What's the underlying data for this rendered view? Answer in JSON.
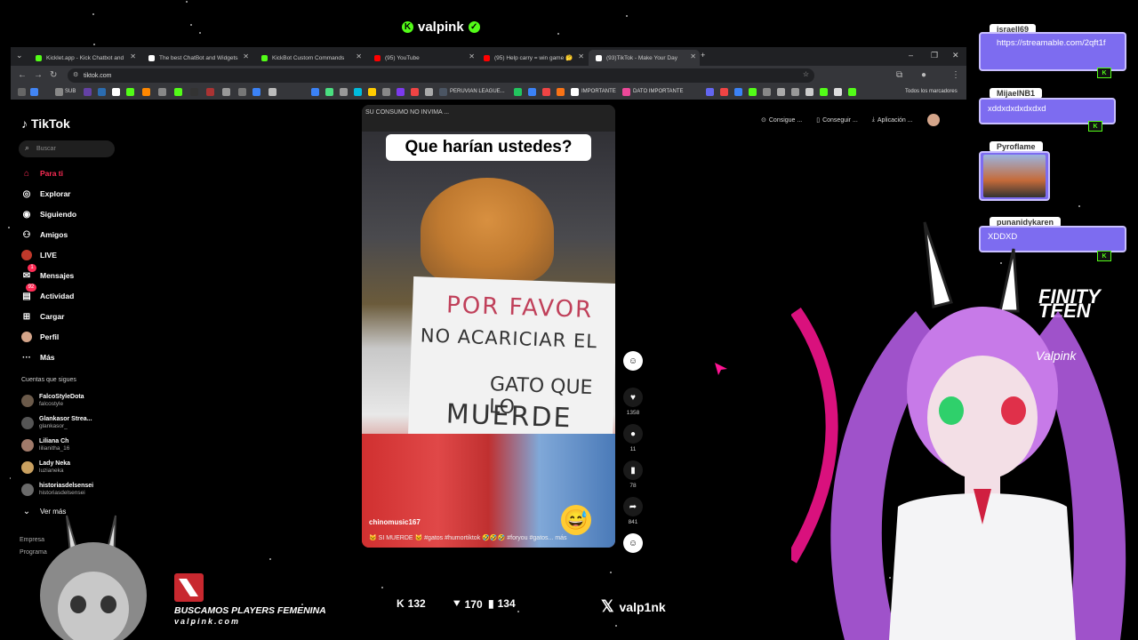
{
  "stream": {
    "channel_name": "valpink",
    "website": "valpink.com",
    "ad_text": "BUSCAMOS PLAYERS FEMENINA",
    "x_handle": "valp1nk",
    "stats": {
      "followers": "132",
      "subs": "170",
      "viewers": "134"
    },
    "avatar_logo": "Valpink"
  },
  "browser": {
    "tabs": [
      {
        "label": "Kicklet.app - Kick Chatbot and",
        "favicon_color": "#53fc18"
      },
      {
        "label": "The best ChatBot and Widgets",
        "favicon_color": "#ffffff"
      },
      {
        "label": "KickBot Custom Commands",
        "favicon_color": "#53fc18"
      },
      {
        "label": "(95) YouTube",
        "favicon_color": "#ff0000"
      },
      {
        "label": "(95) Help carry = win game 🤔",
        "favicon_color": "#ff0000"
      },
      {
        "label": "(93)TikTok - Make Your Day",
        "favicon_color": "#ffffff"
      }
    ],
    "url": "tiktok.com",
    "bookmarks": {
      "sub_label": "SUB",
      "peruvian_league": "PERUVIAN LEAGUE...",
      "importante": "IMPORTANTE",
      "dato_importante": "DATO IMPORTANTE",
      "all_bookmarks": "Todos los marcadores"
    }
  },
  "tiktok": {
    "logo": "TikTok",
    "search_placeholder": "Buscar",
    "nav": [
      {
        "label": "Para ti",
        "icon": "home-icon"
      },
      {
        "label": "Explorar",
        "icon": "compass-icon"
      },
      {
        "label": "Siguiendo",
        "icon": "following-icon"
      },
      {
        "label": "Amigos",
        "icon": "friends-icon"
      },
      {
        "label": "LIVE",
        "icon": "live-icon"
      },
      {
        "label": "Mensajes",
        "icon": "message-icon"
      },
      {
        "label": "Actividad",
        "icon": "activity-icon"
      },
      {
        "label": "Cargar",
        "icon": "upload-icon"
      },
      {
        "label": "Perfil",
        "icon": "profile-icon"
      },
      {
        "label": "Más",
        "icon": "more-icon"
      }
    ],
    "badges": {
      "messages": "1",
      "activity": "92"
    },
    "following_title": "Cuentas que sigues",
    "following": [
      {
        "name": "FalcoStyleDota",
        "handle": "falcostyle"
      },
      {
        "name": "Glankasor Strea...",
        "handle": "glankasor_"
      },
      {
        "name": "Liliana Ch",
        "handle": "lilianitha_16"
      },
      {
        "name": "Lady Neka",
        "handle": "luzianeka"
      },
      {
        "name": "historiasdelsensei",
        "handle": "historiasdelsensei"
      }
    ],
    "see_more": "Ver más",
    "footer_links": [
      "Empresa",
      "Programa"
    ],
    "top_actions": [
      "Consigue ...",
      "Conseguir ...",
      "Aplicación ..."
    ],
    "video": {
      "caption": "Que harían ustedes?",
      "sign_lines": [
        "POR FAVOR",
        "NO ACARICIAR EL",
        "GATO  QUE LO",
        "MUERDE"
      ],
      "top_text": "SU CONSUMO NO INVIMA ...",
      "username": "chinomusic167",
      "description": "🐱 SI MUERDE 🐱 #gatos #humortiktok 🤣🤣🤣 #foryou #gatos... más"
    },
    "actions": {
      "likes": "1358",
      "comments": "11",
      "saves": "78",
      "shares": "841"
    }
  },
  "chat": [
    {
      "user": "israell69",
      "message": "https://streamable.com/2qft1f"
    },
    {
      "user": "MijaelNB1",
      "message": "xddxdxdxdxdxd"
    },
    {
      "user": "Pyroflame",
      "message": ""
    },
    {
      "user": "punanidykaren",
      "message": "XDDXD"
    }
  ],
  "overlay_text": "FINITY\nTEEN"
}
